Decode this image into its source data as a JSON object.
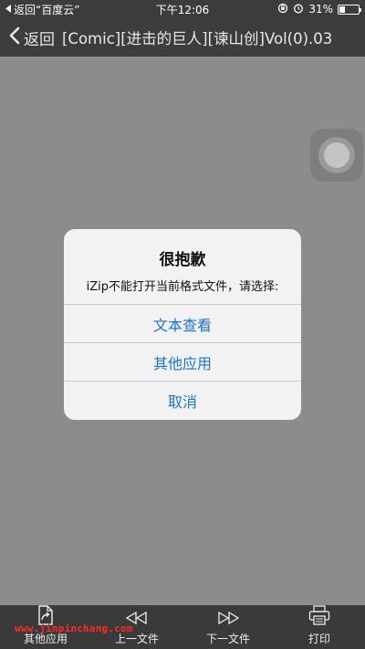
{
  "status_bar": {
    "back_app": "返回“百度云”",
    "time": "下午12:06",
    "battery": "31%",
    "battery_level": 0.31
  },
  "nav": {
    "back_label": "返回",
    "title": "[Comic][进击的巨人][谏山创]Vol(0).03"
  },
  "alert": {
    "title": "很抱歉",
    "message": "iZip不能打开当前格式文件，请选择:",
    "buttons": [
      "文本查看",
      "其他应用",
      "取消"
    ]
  },
  "toolbar": {
    "items": [
      "其他应用",
      "上一文件",
      "下一文件",
      "打印"
    ]
  },
  "watermark": "www.jinpinchang.com",
  "colors": {
    "accent": "#1a73d0",
    "background": "#8c8c8c",
    "bar": "#3a3a3a",
    "watermark": "#ff2a2a"
  }
}
